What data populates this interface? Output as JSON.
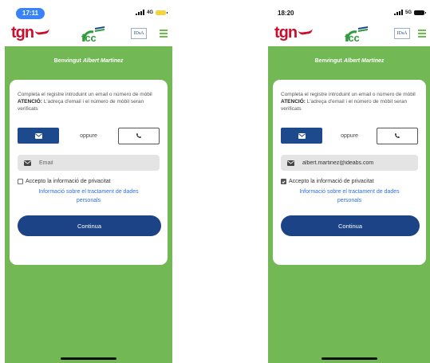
{
  "screens": [
    {
      "status_time": "17:11",
      "network": "4G",
      "welcome_prefix": "Benvingut",
      "user_name": "Albert Martinez",
      "intro_text": "Completa el registre introduint un email o número de mòbil",
      "notice_label": "ATENCIÓ:",
      "notice_text": "L'adreça d'email i el número de mòbil seran verificats",
      "separator_text": "oppure",
      "email_value": "",
      "email_placeholder": "Email",
      "consent_label": "Accepto la informació de privacitat",
      "consent_checked": false,
      "privacy_link": "Informació sobre el tractament de dades personals",
      "continue_label": "Continua"
    },
    {
      "status_time": "18:20",
      "network": "5G",
      "welcome_prefix": "Benvingut",
      "user_name": "Albert Martinez",
      "intro_text": "Completa el registre introduint un email o número de mòbil",
      "notice_label": "ATENCIÓ:",
      "notice_text": "L'adreça d'email i el número de mòbil seran verificats",
      "separator_text": "oppure",
      "email_value": "albert.martinez@ideabs.com",
      "email_placeholder": "Email",
      "consent_label": "Accepto la informació de privacitat",
      "consent_checked": true,
      "privacy_link": "Informació sobre el tractament de dades personals",
      "continue_label": "Continua"
    }
  ],
  "logos": {
    "tgn": "tgn",
    "ideas": "IDsA"
  },
  "icons": {
    "email": "envelope-icon",
    "phone": "phone-icon",
    "menu": "hamburger-menu-icon"
  },
  "colors": {
    "brand_green": "#72b855",
    "primary_blue": "#1b4385",
    "link_blue": "#2f6fde",
    "tgn_red": "#c8102e"
  }
}
